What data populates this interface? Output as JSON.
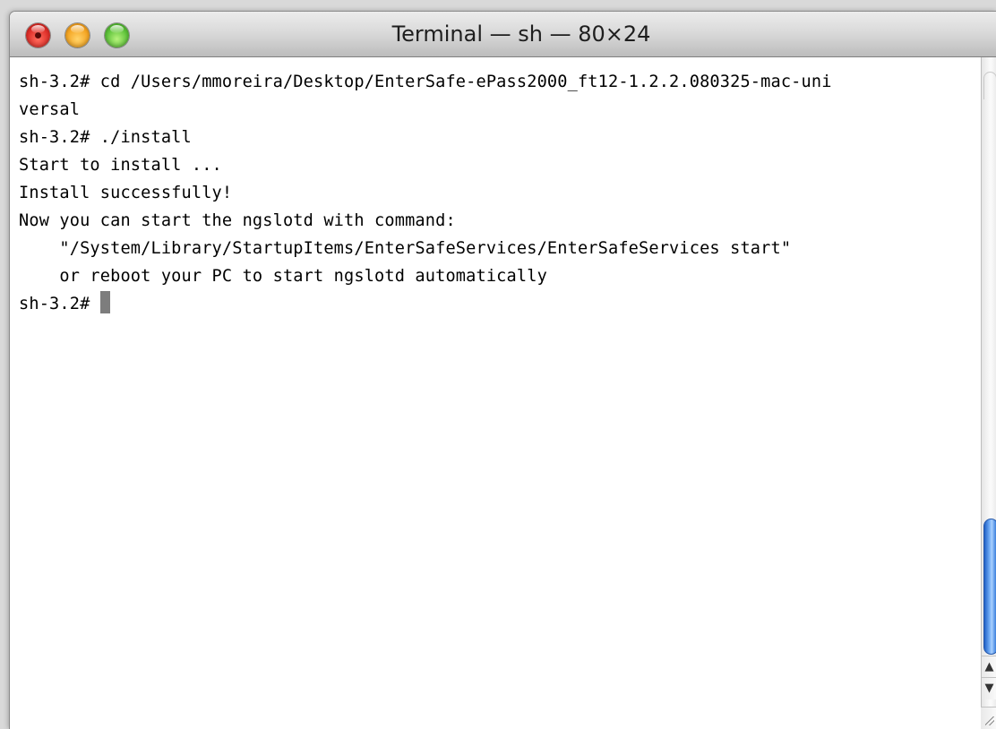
{
  "window": {
    "title": "Terminal — sh — 80×24"
  },
  "terminal": {
    "lines": [
      "sh-3.2# cd /Users/mmoreira/Desktop/EnterSafe-ePass2000_ft12-1.2.2.080325-mac-uni",
      "versal",
      "sh-3.2# ./install",
      "Start to install ...",
      "Install successfully!",
      "Now you can start the ngslotd with command:",
      "    \"/System/Library/StartupItems/EnterSafeServices/EnterSafeServices start\"",
      "    or reboot your PC to start ngslotd automatically"
    ],
    "prompt": "sh-3.2# "
  },
  "scrollbar": {
    "up_arrow": "▲",
    "down_arrow": "▼"
  },
  "colors": {
    "thumb": "#4f8fe4",
    "close": "#e0302a",
    "minimize": "#f5a623",
    "zoom": "#5ec23a"
  }
}
